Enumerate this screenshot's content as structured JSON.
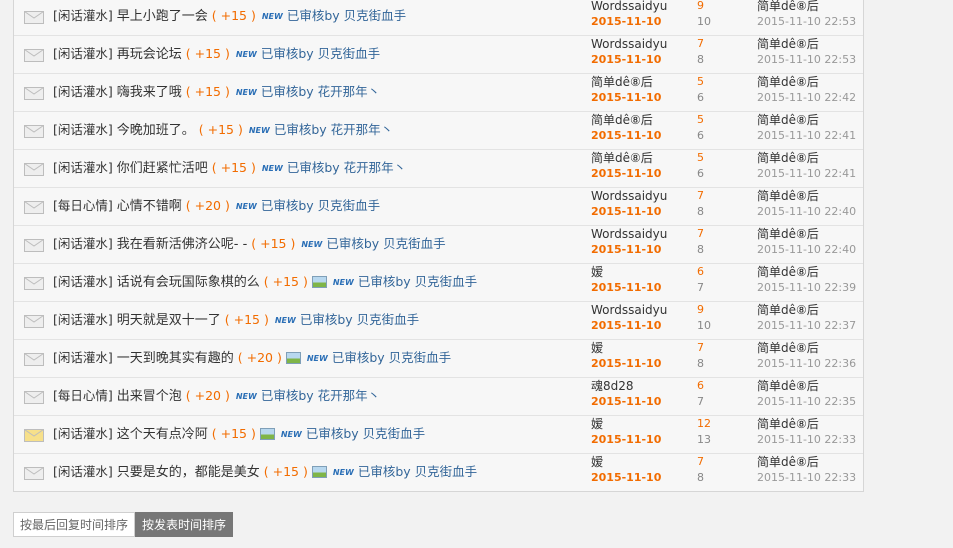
{
  "threads": [
    {
      "category": "[闲话灌水]",
      "title": "早上小跑了一会",
      "points": "( +15 )",
      "has_image": false,
      "reviewer": "已审核by 贝克街血手",
      "author": "Wordssaidyu",
      "post_date": "2015-11-10",
      "replies": "9",
      "views": "10",
      "last_poster": "简单dê⑧后",
      "last_time": "2015-11-10 22:53"
    },
    {
      "category": "[闲话灌水]",
      "title": "再玩会论坛",
      "points": "( +15 )",
      "has_image": false,
      "reviewer": "已审核by 贝克街血手",
      "author": "Wordssaidyu",
      "post_date": "2015-11-10",
      "replies": "7",
      "views": "8",
      "last_poster": "简单dê⑧后",
      "last_time": "2015-11-10 22:53"
    },
    {
      "category": "[闲话灌水]",
      "title": "嗨我来了哦",
      "points": "( +15 )",
      "has_image": false,
      "reviewer": "已审核by 花开那年丶",
      "author": "简单dê⑧后",
      "post_date": "2015-11-10",
      "replies": "5",
      "views": "6",
      "last_poster": "简单dê⑧后",
      "last_time": "2015-11-10 22:42"
    },
    {
      "category": "[闲话灌水]",
      "title": "今晚加班了。",
      "points": "( +15 )",
      "has_image": false,
      "reviewer": "已审核by 花开那年丶",
      "author": "简单dê⑧后",
      "post_date": "2015-11-10",
      "replies": "5",
      "views": "6",
      "last_poster": "简单dê⑧后",
      "last_time": "2015-11-10 22:41"
    },
    {
      "category": "[闲话灌水]",
      "title": "你们赶紧忙活吧",
      "points": "( +15 )",
      "has_image": false,
      "reviewer": "已审核by 花开那年丶",
      "author": "简单dê⑧后",
      "post_date": "2015-11-10",
      "replies": "5",
      "views": "6",
      "last_poster": "简单dê⑧后",
      "last_time": "2015-11-10 22:41"
    },
    {
      "category": "[每日心情]",
      "title": "心情不错啊",
      "points": "( +20 )",
      "has_image": false,
      "reviewer": "已审核by 贝克街血手",
      "author": "Wordssaidyu",
      "post_date": "2015-11-10",
      "replies": "7",
      "views": "8",
      "last_poster": "简单dê⑧后",
      "last_time": "2015-11-10 22:40"
    },
    {
      "category": "[闲话灌水]",
      "title": "我在看新活佛济公呢- -",
      "points": "( +15 )",
      "has_image": false,
      "reviewer": "已审核by 贝克街血手",
      "author": "Wordssaidyu",
      "post_date": "2015-11-10",
      "replies": "7",
      "views": "8",
      "last_poster": "简单dê⑧后",
      "last_time": "2015-11-10 22:40"
    },
    {
      "category": "[闲话灌水]",
      "title": "话说有会玩国际象棋的么",
      "points": "( +15 )",
      "has_image": true,
      "reviewer": "已审核by 贝克街血手",
      "author": "嫒",
      "post_date": "2015-11-10",
      "replies": "6",
      "views": "7",
      "last_poster": "简单dê⑧后",
      "last_time": "2015-11-10 22:39"
    },
    {
      "category": "[闲话灌水]",
      "title": "明天就是双十一了",
      "points": "( +15 )",
      "has_image": false,
      "reviewer": "已审核by 贝克街血手",
      "author": "Wordssaidyu",
      "post_date": "2015-11-10",
      "replies": "9",
      "views": "10",
      "last_poster": "简单dê⑧后",
      "last_time": "2015-11-10 22:37"
    },
    {
      "category": "[闲话灌水]",
      "title": "一天到晚其实有趣的",
      "points": "( +20 )",
      "has_image": true,
      "reviewer": "已审核by 贝克街血手",
      "author": "嫒",
      "post_date": "2015-11-10",
      "replies": "7",
      "views": "8",
      "last_poster": "简单dê⑧后",
      "last_time": "2015-11-10 22:36"
    },
    {
      "category": "[每日心情]",
      "title": "出来冒个泡",
      "points": "( +20 )",
      "has_image": false,
      "reviewer": "已审核by 花开那年丶",
      "author": "魂8d28",
      "post_date": "2015-11-10",
      "replies": "6",
      "views": "7",
      "last_poster": "简单dê⑧后",
      "last_time": "2015-11-10 22:35"
    },
    {
      "category": "[闲话灌水]",
      "title": "这个天有点冷阿",
      "points": "( +15 )",
      "has_image": true,
      "reviewer": "已审核by 贝克街血手",
      "author": "嫒",
      "post_date": "2015-11-10",
      "replies": "12",
      "views": "13",
      "last_poster": "简单dê⑧后",
      "last_time": "2015-11-10 22:33"
    },
    {
      "category": "[闲话灌水]",
      "title": "只要是女的，都能是美女",
      "points": "( +15 )",
      "has_image": true,
      "reviewer": "已审核by 贝克街血手",
      "author": "嫒",
      "post_date": "2015-11-10",
      "replies": "7",
      "views": "8",
      "last_poster": "简单dê⑧后",
      "last_time": "2015-11-10 22:33"
    }
  ],
  "new_badge": "NEW",
  "sort": {
    "by_last_reply": "按最后回复时间排序",
    "by_post_time": "按发表时间排序",
    "active": "by_post_time"
  },
  "colors": {
    "points": "#f26c00",
    "reviewer": "#336699",
    "date": "#f26c00",
    "new_badge": "#2b6fb6"
  },
  "icons": {
    "thread": "envelope-icon",
    "hot_thread": "envelope-hot-icon",
    "image_attachment": "image-icon"
  }
}
